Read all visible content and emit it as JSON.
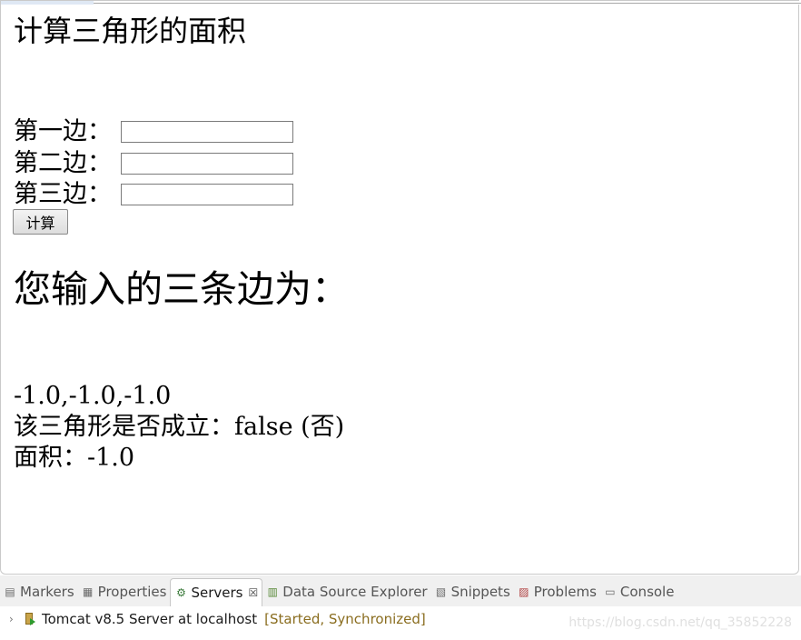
{
  "page": {
    "title": "计算三角形的面积",
    "form": {
      "side1_label": "第一边：",
      "side2_label": "第二边：",
      "side3_label": "第三边：",
      "side1_value": "",
      "side2_value": "",
      "side3_value": "",
      "submit_label": "计算"
    },
    "result": {
      "heading": "您输入的三条边为：",
      "sides": "-1.0,-1.0,-1.0",
      "valid_line": "该三角形是否成立：false (否)",
      "area_line": "面积：-1.0"
    }
  },
  "eclipse": {
    "tabs": [
      {
        "label": "Markers",
        "icon": "markers-icon"
      },
      {
        "label": "Properties",
        "icon": "properties-icon"
      },
      {
        "label": "Servers",
        "icon": "servers-icon",
        "active": true
      },
      {
        "label": "Data Source Explorer",
        "icon": "data-source-icon"
      },
      {
        "label": "Snippets",
        "icon": "snippets-icon"
      },
      {
        "label": "Problems",
        "icon": "problems-icon"
      },
      {
        "label": "Console",
        "icon": "console-icon"
      }
    ],
    "close_glyph": "☒",
    "server": {
      "name": "Tomcat v8.5 Server at localhost",
      "status": "[Started, Synchronized]"
    },
    "watermark": "https://blog.csdn.net/qq_35852228"
  }
}
